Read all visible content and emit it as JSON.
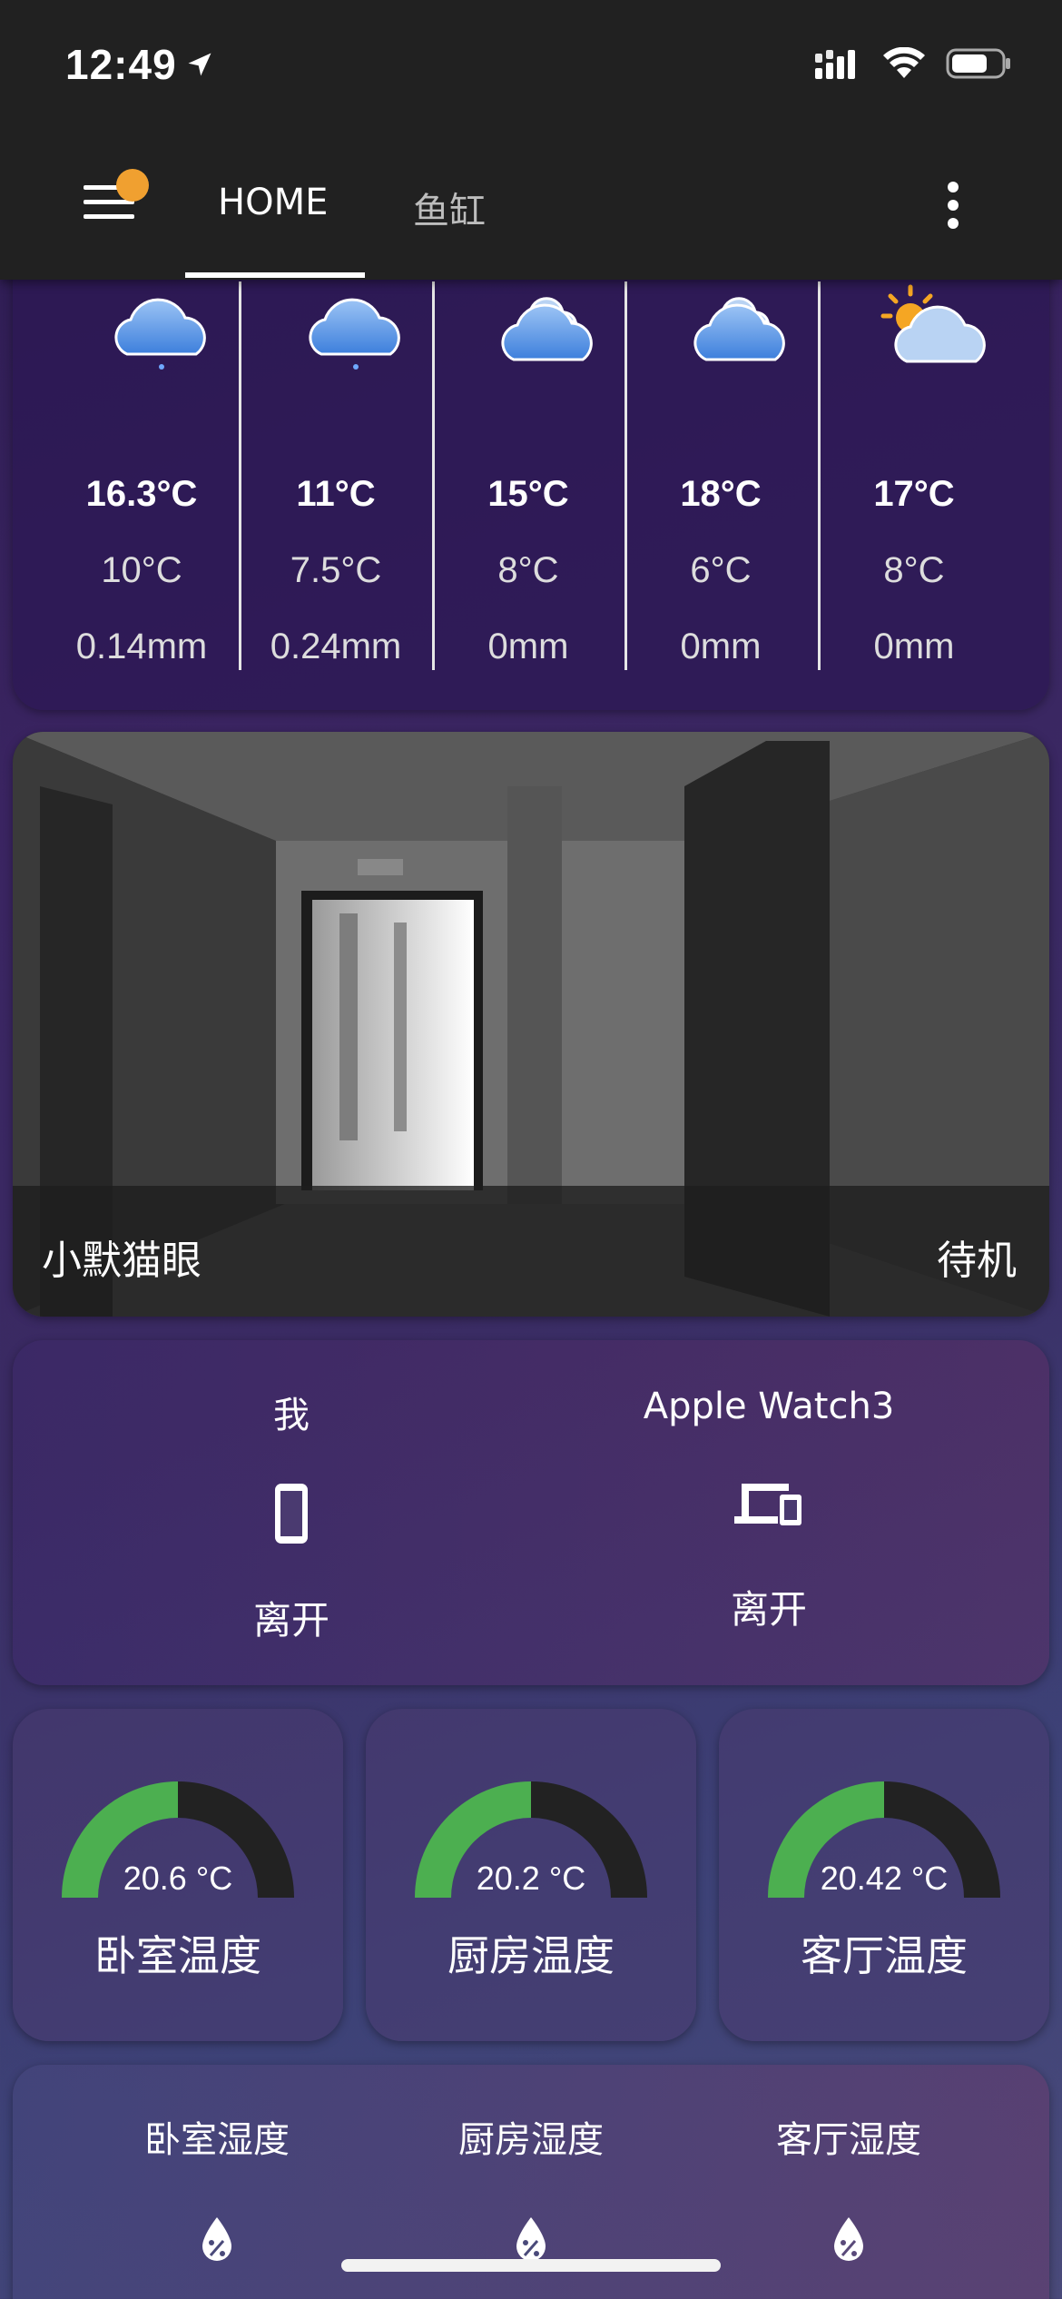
{
  "status_bar": {
    "time": "12:49"
  },
  "header": {
    "tabs": [
      {
        "label": "HOME",
        "active": true
      },
      {
        "label": "鱼缸",
        "active": false
      }
    ],
    "notification_color": "#f0a030"
  },
  "weather": {
    "forecast": [
      {
        "icon": "rainy-cloud-icon",
        "high": "16.3°C",
        "low": "10°C",
        "precipitation": "0.14mm"
      },
      {
        "icon": "rainy-cloud-icon",
        "high": "11°C",
        "low": "7.5°C",
        "precipitation": "0.24mm"
      },
      {
        "icon": "cloudy-icon",
        "high": "15°C",
        "low": "8°C",
        "precipitation": "0mm"
      },
      {
        "icon": "cloudy-icon",
        "high": "18°C",
        "low": "6°C",
        "precipitation": "0mm"
      },
      {
        "icon": "partly-sunny-icon",
        "high": "17°C",
        "low": "8°C",
        "precipitation": "0mm"
      }
    ]
  },
  "camera": {
    "name": "小默猫眼",
    "status": "待机"
  },
  "presence": [
    {
      "name": "我",
      "icon": "phone-icon",
      "state": "离开"
    },
    {
      "name": "Apple Watch3",
      "icon": "devices-icon",
      "state": "离开"
    }
  ],
  "temperatures": [
    {
      "value": 20.6,
      "display": "20.6 °C",
      "name": "卧室温度",
      "fill_fraction": 0.5
    },
    {
      "value": 20.2,
      "display": "20.2 °C",
      "name": "厨房温度",
      "fill_fraction": 0.5
    },
    {
      "value": 20.42,
      "display": "20.42 °C",
      "name": "客厅温度",
      "fill_fraction": 0.5
    }
  ],
  "humidity": [
    {
      "name": "卧室湿度",
      "icon": "water-percent-icon"
    },
    {
      "name": "厨房湿度",
      "icon": "water-percent-icon"
    },
    {
      "name": "客厅湿度",
      "icon": "water-percent-icon"
    }
  ],
  "colors": {
    "gauge_fill": "#4caf50",
    "gauge_track": "#222222",
    "header_bg": "#212121"
  }
}
